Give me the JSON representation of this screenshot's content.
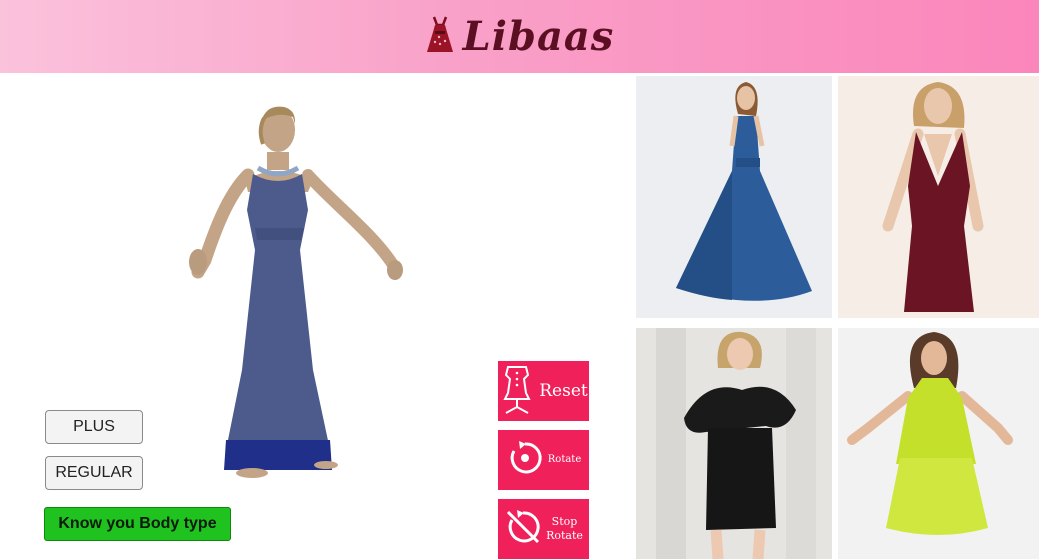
{
  "header": {
    "brand": "Libaas",
    "logo_icon": "dress-icon",
    "colors": {
      "brand_text": "#5a0f22",
      "banner": "#f9a0c8"
    }
  },
  "avatar": {
    "dress_color": "#4c5a8c",
    "hem_color": "#1f2f8a"
  },
  "size_buttons": [
    {
      "label": "PLUS"
    },
    {
      "label": "REGULAR"
    }
  ],
  "body_type_button": {
    "label": "Know you Body type",
    "color": "#1fc21f"
  },
  "controls": {
    "reset": {
      "label": "Reset",
      "icon": "dress-form-icon"
    },
    "rotate": {
      "label": "Rotate",
      "icon": "rotate-icon"
    },
    "stop_rotate": {
      "line1": "Stop",
      "line2": "Rotate",
      "icon": "stop-rotate-icon"
    },
    "color": "#f0205a"
  },
  "gallery": [
    {
      "name": "blue maxi halter gown",
      "dress_color": "#2c5d9a"
    },
    {
      "name": "burgundy bodycon dress",
      "dress_color": "#6a1424"
    },
    {
      "name": "black ruffle mini dress",
      "dress_color": "#161616"
    },
    {
      "name": "lime halter dress",
      "dress_color": "#c4e02a"
    }
  ]
}
